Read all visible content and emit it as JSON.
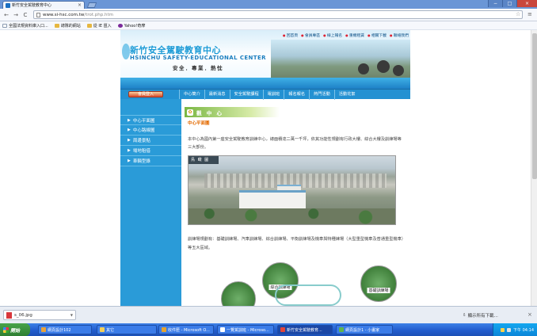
{
  "browser": {
    "tab_title": "新竹安全駕駛教育中心",
    "tab_close": "×",
    "url_host": "www.si-hsc.com.tw",
    "url_path": "/trot.php.htm",
    "window_controls": [
      "−",
      "□",
      "×"
    ],
    "nav": {
      "back": "←",
      "forward": "→",
      "reload": "C"
    },
    "star": "☆",
    "menu": "≡"
  },
  "bookmarks": [
    {
      "label": "全國法規資料庫入口...",
      "icon": "page"
    },
    {
      "label": "總隊的網站",
      "icon": "folder"
    },
    {
      "label": "從 IE 匯入",
      "icon": "folder"
    },
    {
      "label": "Yahoo!奇摩",
      "icon": "yahoo"
    }
  ],
  "site": {
    "topnav": [
      "回首頁",
      "會員專區",
      "線上報名",
      "重機租賃",
      "相關下載",
      "聯絡我們"
    ],
    "logo_title": "新竹安全駕駛教育中心",
    "logo_en": "HSINCHU SAFETY-EDUCATIONAL CENTER",
    "slogan": "安全．專業．熱忱",
    "member_login": "會員登入",
    "mainnav": [
      "中心簡介",
      "最新消息",
      "安全駕駛課程",
      "電訓班",
      "報名報名",
      "熱門活動",
      "活動花絮"
    ],
    "sidebar": [
      "中心平面圖",
      "中心路線圖",
      "周邊景點",
      "場地租借",
      "車輛型錄"
    ],
    "section_title": "觀 中 心",
    "section_icon": "✿",
    "section_sub": "中心平面圖",
    "para1": "本中心為國內第一座安全駕駛教育訓練中心，總面積達二萬一千坪，依其功能性規劃有行政大樓、綜合大樓及訓練場等三大部份。",
    "aerial_caption": "鳥 瞰 圖",
    "para2": "訓練場規劃有：基礎訓練場、汽車訓練場、綜合訓練場、平衡訓練場及機車與特種練場（大型重型機車及普通重型機車）等五大區域。",
    "map_labels": [
      "綜合訓練場",
      "基礎訓練場"
    ]
  },
  "download_bar": {
    "file": "s_06.jpg",
    "show_all": "顯示所有下載...",
    "close": "×"
  },
  "taskbar": {
    "start": "開始",
    "items": [
      {
        "label": "網頁設計102",
        "color": "#e8a23a"
      },
      {
        "label": "其它",
        "color": "#f2cf5a"
      },
      {
        "label": "收件匣 - Microsoft O...",
        "color": "#e5a42f"
      },
      {
        "label": "一覽駕訓班 - Microso...",
        "color": "#ffffff"
      },
      {
        "label": "新竹安全駕駛教育...",
        "color": "#e2453a",
        "active": true
      },
      {
        "label": "網頁設計1 - 小畫家",
        "color": "#5fb54b"
      }
    ],
    "clock": "下午 04:14"
  }
}
